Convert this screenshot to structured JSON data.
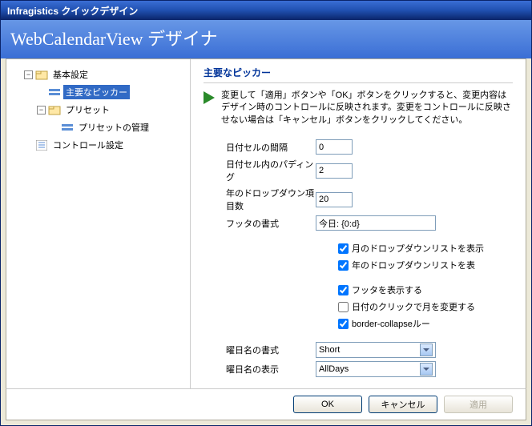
{
  "window": {
    "title": "Infragistics クイックデザイン"
  },
  "header": {
    "title": "WebCalendarView デザイナ"
  },
  "tree": {
    "root": {
      "toggle": "−",
      "label": "基本設定"
    },
    "picker": {
      "label": "主要なピッカー"
    },
    "preset": {
      "toggle": "−",
      "label": "プリセット"
    },
    "presetMgmt": {
      "label": "プリセットの管理"
    },
    "control": {
      "label": "コントロール設定"
    }
  },
  "panel": {
    "title": "主要なピッカー",
    "description": "変更して「適用」ボタンや「OK」ボタンをクリックすると、変更内容はデザイン時のコントロールに反映されます。変更をコントロールに反映させない場合は「キャンセル」ボタンをクリックしてください。",
    "fields": {
      "cellSpacing": {
        "label": "日付セルの間隔",
        "value": "0"
      },
      "cellPadding": {
        "label": "日付セル内のパディング",
        "value": "2"
      },
      "yearDropdown": {
        "label": "年のドロップダウン項目数",
        "value": "20"
      },
      "footerFormat": {
        "label": "フッタの書式",
        "value": "今日: {0:d}"
      },
      "dayNameFormat": {
        "label": "曜日名の書式",
        "value": "Short"
      },
      "dayNameDisplay": {
        "label": "曜日名の表示",
        "value": "AllDays"
      }
    },
    "checks": {
      "showMonthDrop": {
        "label": "月のドロップダウンリストを表示",
        "checked": true
      },
      "showYearDrop": {
        "label": "年のドロップダウンリストを表",
        "checked": true
      },
      "showFooter": {
        "label": "フッタを表示する",
        "checked": true
      },
      "clickChangeMonth": {
        "label": "日付のクリックで月を変更する",
        "checked": false
      },
      "borderCollapse": {
        "label": "border-collapseルー",
        "checked": true
      }
    }
  },
  "footer": {
    "ok": "OK",
    "cancel": "キャンセル",
    "apply": "適用"
  }
}
